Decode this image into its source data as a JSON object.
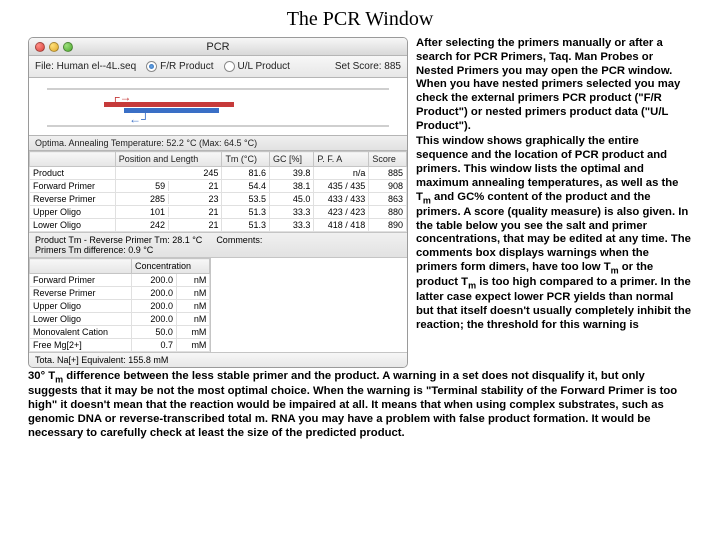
{
  "slide_title": "The PCR Window",
  "window": {
    "title": "PCR",
    "file_label": "File: Human el--4L.seq",
    "radio1": "F/R Product",
    "radio2": "U/L Product",
    "set_score": "Set Score: 885",
    "anneal_line": "Optima. Annealing Temperature: 52.2 °C (Max: 64.5 °C)"
  },
  "headers": {
    "pos": "Position and Length",
    "tm": "Tm (°C)",
    "gc": "GC [%]",
    "pa": "P. F. A",
    "score": "Score"
  },
  "rows": [
    {
      "name": "Product",
      "pos": "245",
      "tm": "81.6",
      "gc": "39.8",
      "pa": "n/a",
      "score": "885"
    },
    {
      "name": "Forward Primer",
      "pos1": "59",
      "pos2": "21",
      "tm": "54.4",
      "gc": "38.1",
      "pa": "435 / 435",
      "score": "908"
    },
    {
      "name": "Reverse Primer",
      "pos1": "285",
      "pos2": "23",
      "tm": "53.5",
      "gc": "45.0",
      "pa": "433 / 433",
      "score": "863"
    },
    {
      "name": "Upper Oligo",
      "pos1": "101",
      "pos2": "21",
      "tm": "51.3",
      "gc": "33.3",
      "pa": "423 / 423",
      "score": "880"
    },
    {
      "name": "Lower Oligo",
      "pos1": "242",
      "pos2": "21",
      "tm": "51.3",
      "gc": "33.3",
      "pa": "418 / 418",
      "score": "890"
    }
  ],
  "mid": {
    "l1": "Product Tm - Reverse Primer Tm: 28.1 °C",
    "l2": "Primers Tm difference: 0.9 °C",
    "comments_label": "Comments:"
  },
  "conc_header": "Concentration",
  "conc_rows": [
    {
      "name": "Forward Primer",
      "val": "200.0",
      "unit": "nM"
    },
    {
      "name": "Reverse Primer",
      "val": "200.0",
      "unit": "nM"
    },
    {
      "name": "Upper Oligo",
      "val": "200.0",
      "unit": "nM"
    },
    {
      "name": "Lower Oligo",
      "val": "200.0",
      "unit": "nM"
    },
    {
      "name": "Monovalent Cation",
      "val": "50.0",
      "unit": "mM"
    },
    {
      "name": "Free Mg[2+]",
      "val": "0.7",
      "unit": "mM"
    }
  ],
  "footer": "Tota. Na[+] Equivalent: 155.8 mM",
  "text": {
    "p1a": "After selecting the primers manually or after a search for PCR Primers, Taq. Man Probes or Nested Primers you may open the PCR window. When you have nested primers selected you may check the external primers PCR product (\"F/R Product\") or nested primers product data (\"U/L Product\").",
    "p2a": "This window shows graphically the entire sequence and the location of PCR product and primers. This window lists the optimal and maximum annealing temperatures, as well as the T",
    "p2b": " and GC% content of the product and the primers. A score (quality measure) is also given. In the table below you see the salt and primer concentrations, that may be edited at any time. The comments box displays warnings when the primers form dimers, have too low T",
    "p2c": " or the product T",
    "p2d": " is too high compared to a primer. In the latter case expect lower PCR yields than normal but that itself doesn't usually completely inhibit the reaction; the threshold for this warning is",
    "bottom_a": "30° T",
    "bottom_b": " difference between the less stable primer and the product. A warning in a set does not disqualify it, but only suggests that it may be not the most optimal choice. When the warning is \"Terminal stability of the Forward Primer is too high\" it doesn't mean that the reaction would be impaired at all. It means that when using complex substrates, such as genomic DNA or reverse-transcribed total m. RNA you may have a problem with false product formation. It would be necessary to carefully check at least the size of the predicted product."
  }
}
